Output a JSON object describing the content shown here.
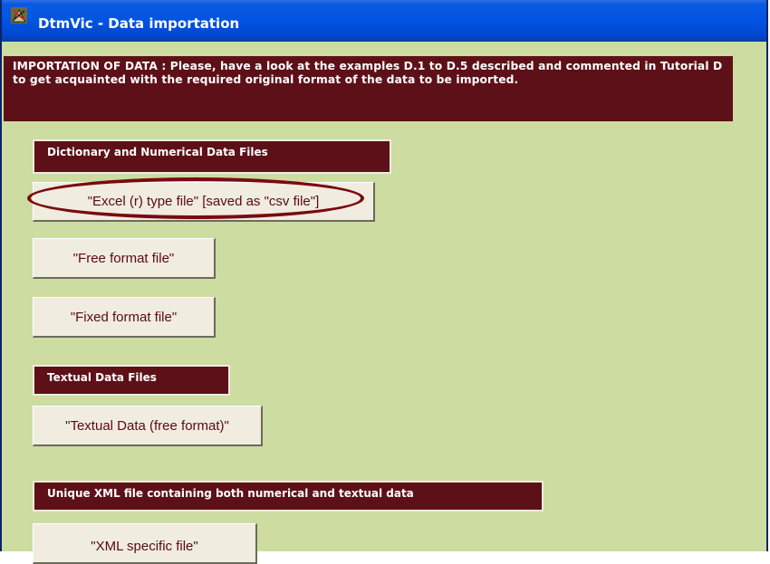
{
  "window": {
    "title": "DtmVic - Data importation",
    "icon": "dtmvic-app-icon"
  },
  "banner": {
    "text": "IMPORTATION OF DATA :  Please, have a look at the examples D.1 to D.5    described and commented  in Tutorial D  to get acquainted with the required   original format of the data  to be imported."
  },
  "sections": {
    "dictionary": "Dictionary and  Numerical Data Files",
    "textual": "Textual Data Files",
    "xml": "Unique XML file containing both numerical and textual data"
  },
  "buttons": {
    "excel": "\"Excel (r) type file\" [saved as \"csv file\"]",
    "free_format": "\"Free format file\"",
    "fixed_format": "\"Fixed format file\"",
    "textual_free": "\"Textual Data (free format)\"",
    "xml_specific": "\"XML specific file\""
  },
  "colors": {
    "background": "#cddca0",
    "banner": "#5e1018",
    "button_face": "#f0ece0",
    "button_text": "#5a0a0f",
    "highlight": "#7a0a10",
    "titlebar": "#0054e3"
  }
}
